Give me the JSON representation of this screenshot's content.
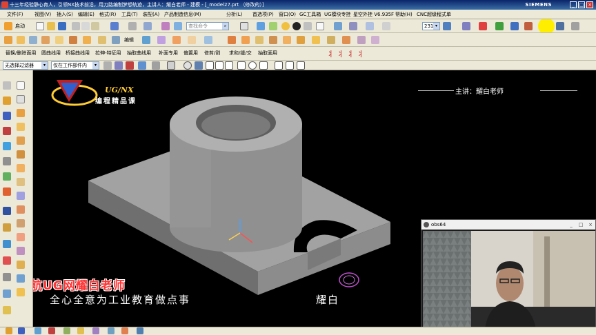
{
  "window": {
    "title": "十三年经验静心育人，引领NX技术前沿，用刀路编制梦想轨迹，主讲人：耀白老师 - 建模 - [_model27.prt （修改的）]",
    "brand": "SIEMENS"
  },
  "menu": {
    "items": [
      "文件(F)",
      "视图(V)",
      "插入(S)",
      "编辑(E)",
      "格式(R)",
      "工具(T)",
      "装配(A)",
      "产品制造信息(M)",
      "分析(L)",
      "首选项(P)",
      "窗口(O)",
      "GC工具箱",
      "UG模块专挂",
      "星空外挂 V6.935F",
      "帮助(H)",
      "CNC超级程式单"
    ]
  },
  "toolbar1": {
    "start_label": "启动",
    "search_placeholder": "查找命令",
    "zoom_value": "231"
  },
  "toolbar2": {
    "edit_label": "编辑"
  },
  "toolbar3": {
    "labels": [
      "替换/删除面用",
      "圆曲线用",
      "桥接曲线用",
      "拉伸-特征用",
      "抽取曲线用",
      "补面专用",
      "偏置用",
      "修剪/割",
      "求和/缝/交",
      "抽取面用"
    ]
  },
  "filterbar": {
    "type_filter": "无选择过滤器",
    "scope_filter": "仅在工作部件内"
  },
  "viewport": {
    "logo_title": "UG/NX",
    "logo_subtitle": "编程精品课",
    "lecturer": "主讲：耀白老师",
    "slogan_red": "星航UG网耀白老师",
    "slogan_white": "全心全意为工业教育做点事",
    "slogan_name": "耀白"
  },
  "camera": {
    "title": "obs64"
  },
  "colors": {
    "accent_yellow": "#ffcc33",
    "slogan_red": "#ff3333",
    "model_gray": "#8a8a8a"
  }
}
